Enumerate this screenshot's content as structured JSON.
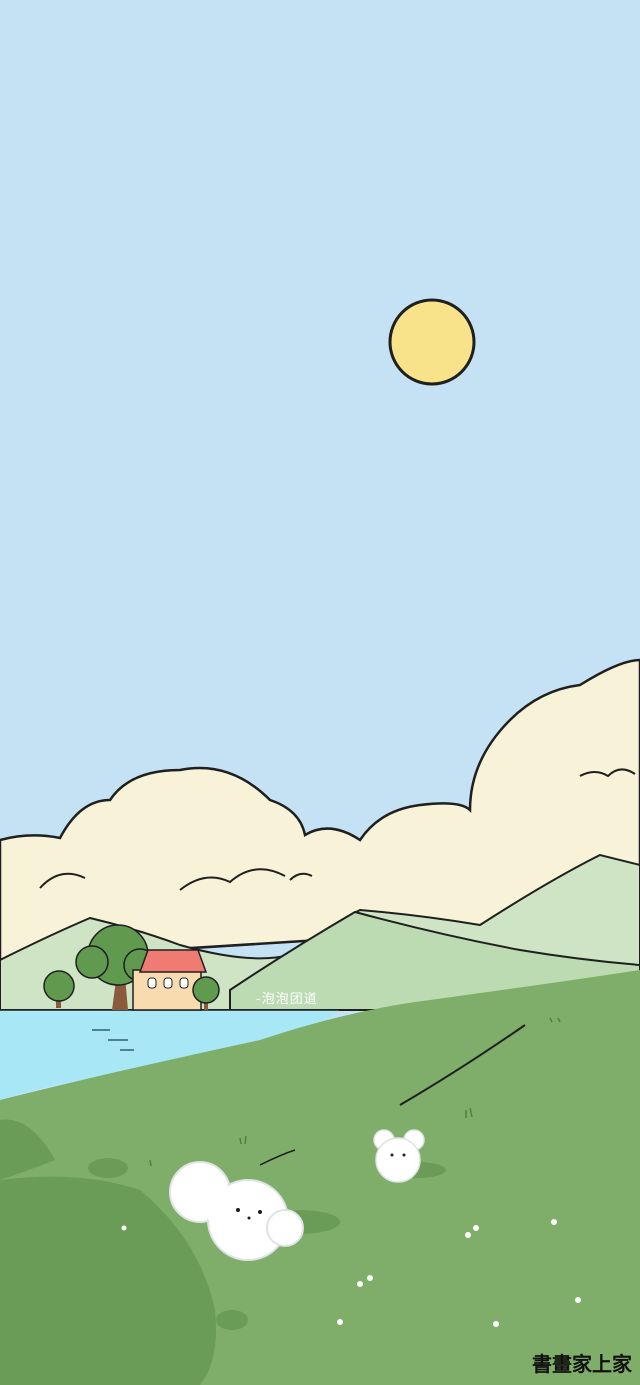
{
  "signature": "-泡泡团道",
  "watermark": "書畫家上家",
  "colors": {
    "sky": "#c4e2f4",
    "sun": "#f8e38a",
    "cloud": "#f8f2d8",
    "hill_back": "#cfe4c4",
    "hill_mid": "#bcdbb2",
    "lake": "#a8e8f6",
    "meadow": "#7fae6a",
    "meadow_dark": "#6a9c58",
    "roof": "#f07b72",
    "house_wall": "#f8dcb0",
    "tree": "#5f9a4e",
    "trunk": "#8a5a3c",
    "outline": "#1f1f1f"
  },
  "icons": [
    "sun-icon",
    "house-icon",
    "tree-icon",
    "puppy-icon",
    "flower-icon"
  ]
}
